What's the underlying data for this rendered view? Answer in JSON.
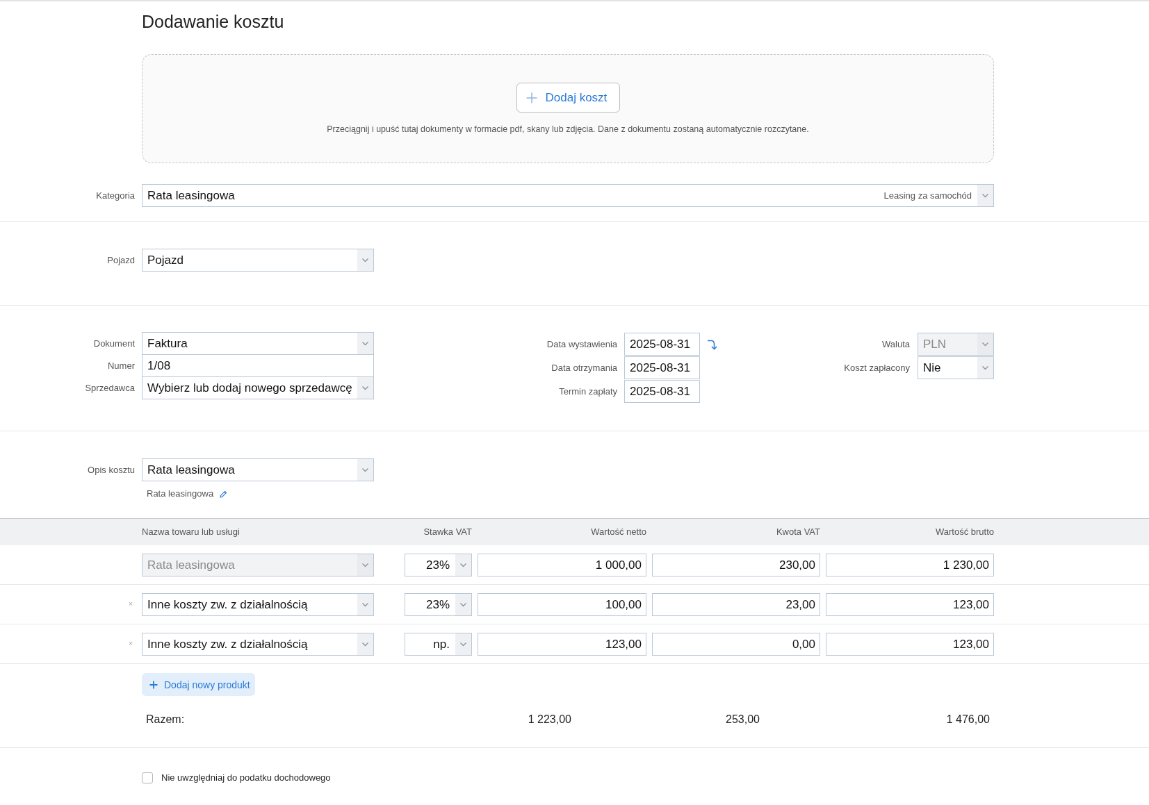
{
  "page": {
    "title": "Dodawanie kosztu"
  },
  "upload": {
    "button": "Dodaj koszt",
    "hint": "Przeciągnij i upuść tutaj dokumenty w formacie pdf, skany lub zdjęcia. Dane z dokumentu zostaną automatycznie rozczytane."
  },
  "category": {
    "label": "Kategoria",
    "value": "Rata leasingowa",
    "detail": "Leasing za samochód"
  },
  "vehicle": {
    "label": "Pojazd",
    "value": "Pojazd"
  },
  "document": {
    "fields": [
      {
        "kind": "select",
        "label": "Dokument",
        "value": "Faktura"
      },
      {
        "kind": "input",
        "label": "Numer",
        "value": "1/08"
      },
      {
        "kind": "select",
        "label": "Sprzedawca",
        "value": "Wybierz lub dodaj nowego sprzedawcę"
      }
    ]
  },
  "dates": {
    "fields": [
      {
        "label": "Data wystawienia",
        "value": "2025-08-31"
      },
      {
        "label": "Data otrzymania",
        "value": "2025-08-31"
      },
      {
        "label": "Termin zapłaty",
        "value": "2025-08-31"
      }
    ]
  },
  "payment": {
    "fields": [
      {
        "label": "Waluta",
        "value": "PLN",
        "disabled": true
      },
      {
        "label": "Koszt zapłacony",
        "value": "Nie",
        "disabled": false
      }
    ]
  },
  "description": {
    "label": "Opis kosztu",
    "value": "Rata leasingowa",
    "note": "Rata leasingowa"
  },
  "items": {
    "columns": [
      "Nazwa towaru lub usługi",
      "Stawka VAT",
      "Wartość netto",
      "Kwota VAT",
      "Wartość brutto"
    ],
    "rows": [
      {
        "name": "Rata leasingowa",
        "disabled": true,
        "vat_rate": "23%",
        "net": "1 000,00",
        "vat": "230,00",
        "gross": "1 230,00"
      },
      {
        "remove": "×",
        "name": "Inne koszty zw. z działalnością",
        "disabled": false,
        "vat_rate": "23%",
        "net": "100,00",
        "vat": "23,00",
        "gross": "123,00"
      },
      {
        "remove": "×",
        "name": "Inne koszty zw. z działalnością",
        "disabled": false,
        "vat_rate": "np.",
        "net": "123,00",
        "vat": "0,00",
        "gross": "123,00"
      }
    ],
    "add_button": "Dodaj nowy produkt",
    "totals": {
      "label": "Razem:",
      "net": "1 223,00",
      "vat": "253,00",
      "gross": "1 476,00"
    }
  },
  "options": [
    {
      "label": "Nie uwzględniaj do podatku dochodowego",
      "checked": false
    }
  ]
}
